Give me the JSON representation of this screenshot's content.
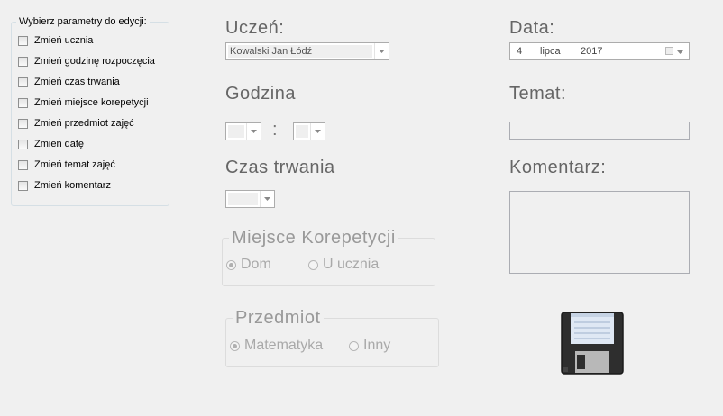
{
  "params": {
    "legend": "Wybierz parametry do edycji:",
    "items": [
      {
        "label": "Zmień ucznia",
        "checked": false
      },
      {
        "label": "Zmień godzinę rozpoczęcia",
        "checked": false
      },
      {
        "label": "Zmień czas trwania",
        "checked": false
      },
      {
        "label": "Zmień miejsce korepetycji",
        "checked": false
      },
      {
        "label": "Zmień przedmiot zajęć",
        "checked": false
      },
      {
        "label": "Zmień datę",
        "checked": false
      },
      {
        "label": "Zmień temat zajęć",
        "checked": false
      },
      {
        "label": "Zmień komentarz",
        "checked": false
      }
    ]
  },
  "student": {
    "label": "Uczeń:",
    "value": "Kowalski Jan Łódź"
  },
  "date": {
    "label": "Data:",
    "day": "4",
    "month": "lipca",
    "year": "2017"
  },
  "hour": {
    "label": "Godzina",
    "separator": ":",
    "hours_value": "",
    "minutes_value": ""
  },
  "topic": {
    "label": "Temat:",
    "value": ""
  },
  "duration": {
    "label": "Czas trwania",
    "value": ""
  },
  "comment": {
    "label": "Komentarz:",
    "value": ""
  },
  "place": {
    "legend": "Miejsce Korepetycji",
    "options": [
      {
        "label": "Dom",
        "checked": true
      },
      {
        "label": "U ucznia",
        "checked": false
      }
    ]
  },
  "subject": {
    "legend": "Przedmiot",
    "options": [
      {
        "label": "Matematyka",
        "checked": true
      },
      {
        "label": "Inny",
        "checked": false
      }
    ]
  },
  "save": {
    "icon": "floppy-disk-icon"
  }
}
